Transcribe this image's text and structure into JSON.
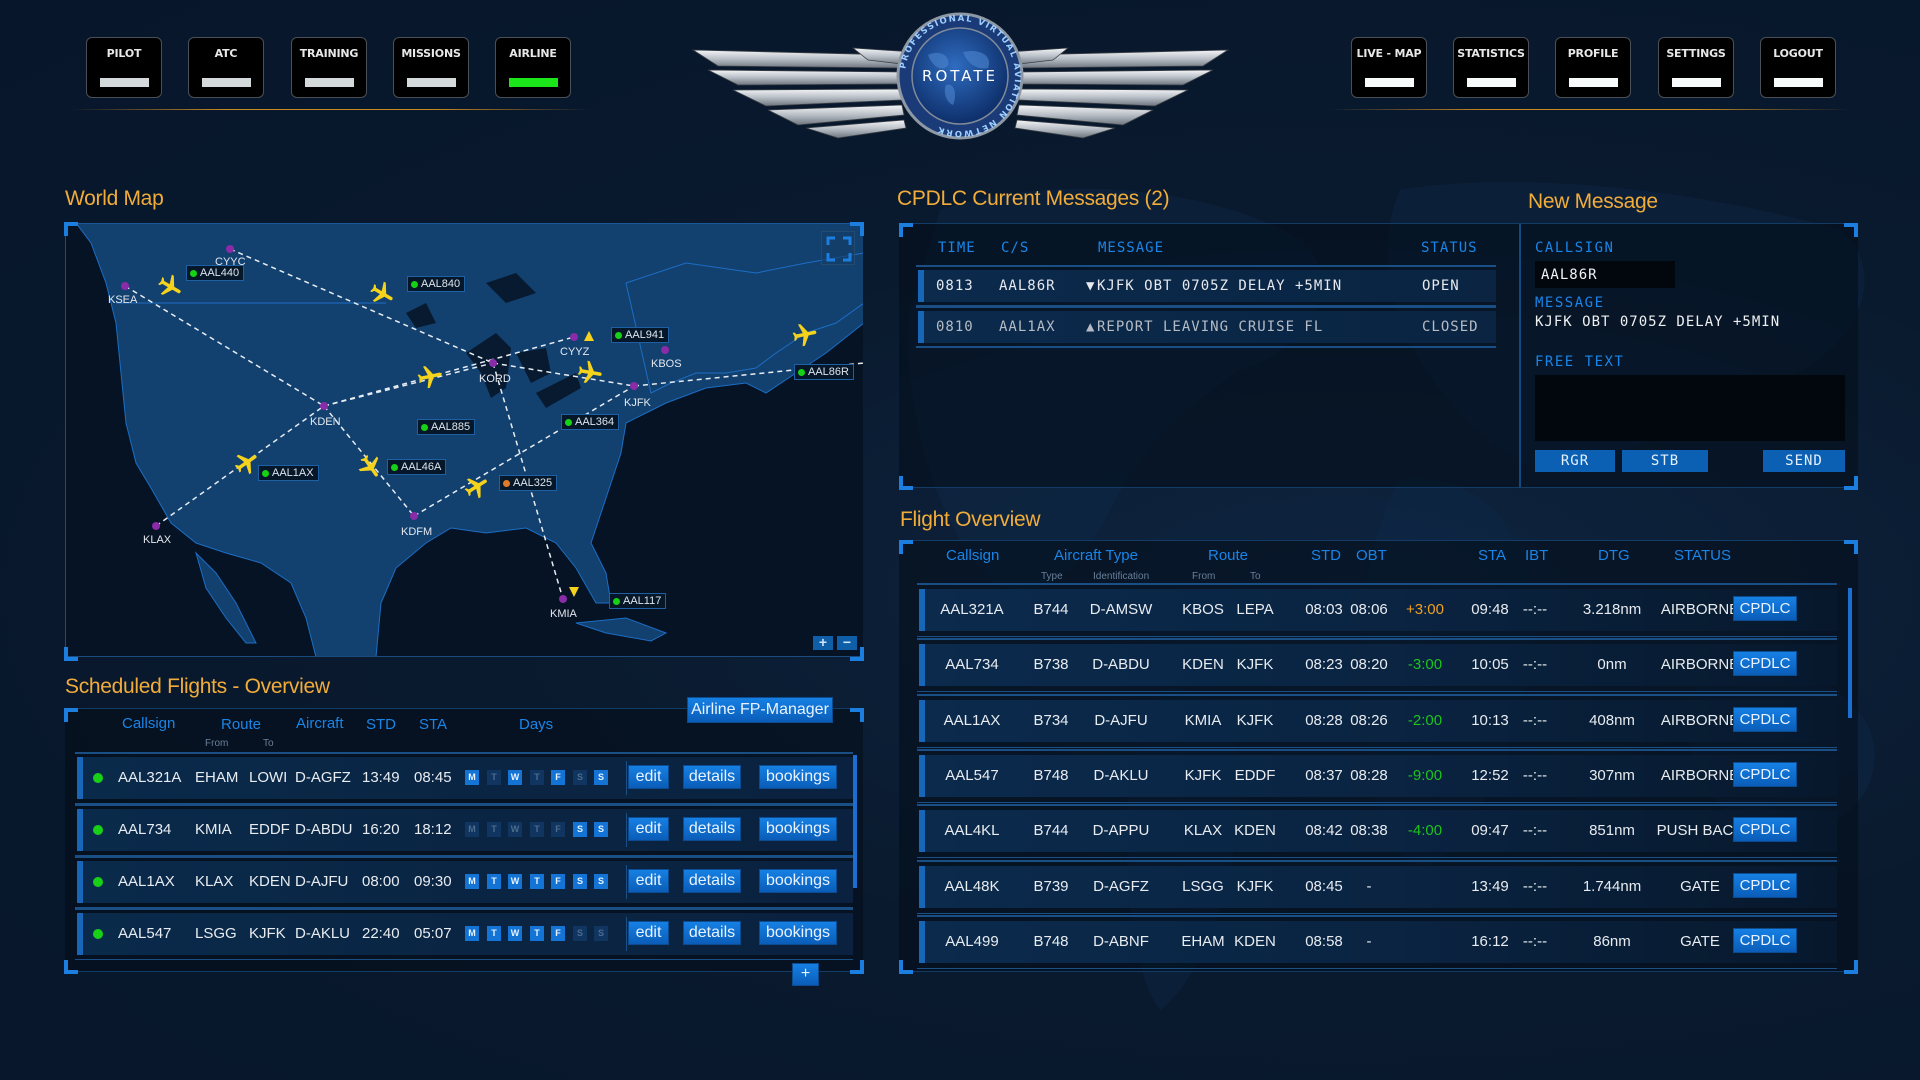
{
  "nav": {
    "left": [
      {
        "label": "PILOT",
        "active": false
      },
      {
        "label": "ATC",
        "active": false
      },
      {
        "label": "TRAINING",
        "active": false
      },
      {
        "label": "MISSIONS",
        "active": false
      },
      {
        "label": "AIRLINE",
        "active": true
      }
    ],
    "right": [
      {
        "label": "LIVE - MAP"
      },
      {
        "label": "STATISTICS"
      },
      {
        "label": "PROFILE"
      },
      {
        "label": "SETTINGS"
      },
      {
        "label": "LOGOUT"
      }
    ]
  },
  "logo": {
    "name": "ROTATE",
    "ring_text": "PROFESSIONAL VIRTUAL AVIATION NETWORK"
  },
  "colors": {
    "accent_title": "#f1ac3a",
    "header_blue": "#1a85e8",
    "button_blue": "#1474d6",
    "status_green": "#17d017",
    "delay_positive": "#f0a020",
    "delay_negative": "#1cc41c",
    "plane_yellow": "#f5d21c"
  },
  "world_map": {
    "title": "World Map",
    "airports": [
      {
        "code": "CYYC"
      },
      {
        "code": "KSEA"
      },
      {
        "code": "KDEN"
      },
      {
        "code": "KORD"
      },
      {
        "code": "CYYZ"
      },
      {
        "code": "KBOS"
      },
      {
        "code": "KJFK"
      },
      {
        "code": "KLAX"
      },
      {
        "code": "KDFM"
      },
      {
        "code": "KMIA"
      }
    ],
    "flights": [
      {
        "callsign": "AAL440",
        "status": "green"
      },
      {
        "callsign": "AAL840",
        "status": "green"
      },
      {
        "callsign": "AAL941",
        "status": "green"
      },
      {
        "callsign": "AAL885",
        "status": "green"
      },
      {
        "callsign": "AAL364",
        "status": "green"
      },
      {
        "callsign": "AAL86R",
        "status": "green"
      },
      {
        "callsign": "AAL1AX",
        "status": "green"
      },
      {
        "callsign": "AAL46A",
        "status": "green"
      },
      {
        "callsign": "AAL325",
        "status": "orange"
      },
      {
        "callsign": "AAL117",
        "status": "green"
      }
    ],
    "zoom_in": "+",
    "zoom_out": "−"
  },
  "scheduled": {
    "title": "Scheduled Flights -  Overview",
    "manager_button": "Airline FP-Manager",
    "headers": {
      "callsign": "Callsign",
      "route": "Route",
      "route_from": "From",
      "route_to": "To",
      "aircraft": "Aircraft",
      "std": "STD",
      "sta": "STA",
      "days": "Days"
    },
    "day_letters": [
      "M",
      "T",
      "W",
      "T",
      "F",
      "S",
      "S"
    ],
    "rows": [
      {
        "callsign": "AAL321A",
        "from": "EHAM",
        "to": "LOWI",
        "aircraft": "D-AGFZ",
        "std": "13:49",
        "sta": "08:45",
        "days": [
          1,
          0,
          1,
          0,
          1,
          0,
          1
        ]
      },
      {
        "callsign": "AAL734",
        "from": "KMIA",
        "to": "EDDF",
        "aircraft": "D-ABDU",
        "std": "16:20",
        "sta": "18:12",
        "days": [
          0,
          0,
          0,
          0,
          0,
          1,
          1
        ]
      },
      {
        "callsign": "AAL1AX",
        "from": "KLAX",
        "to": "KDEN",
        "aircraft": "D-AJFU",
        "std": "08:00",
        "sta": "09:30",
        "days": [
          1,
          1,
          1,
          1,
          1,
          1,
          1
        ]
      },
      {
        "callsign": "AAL547",
        "from": "LSGG",
        "to": "KJFK",
        "aircraft": "D-AKLU",
        "std": "22:40",
        "sta": "05:07",
        "days": [
          1,
          1,
          1,
          1,
          1,
          0,
          0
        ]
      }
    ],
    "row_buttons": {
      "edit": "edit",
      "details": "details",
      "bookings": "bookings"
    },
    "add_button": "+"
  },
  "cpdlc": {
    "title": "CPDLC Current Messages (2)",
    "headers": {
      "time": "TIME",
      "cs": "C/S",
      "message": "MESSAGE",
      "status": "STATUS"
    },
    "messages": [
      {
        "time": "0813",
        "cs": "AAL86R",
        "dir": "▼",
        "message": "KJFK OBT 0705Z DELAY +5MIN",
        "status": "OPEN"
      },
      {
        "time": "0810",
        "cs": "AAL1AX",
        "dir": "▲",
        "message": "REPORT LEAVING CRUISE FL",
        "status": "CLOSED"
      }
    ]
  },
  "new_message": {
    "title": "New Message",
    "callsign_label": "CALLSIGN",
    "callsign_value": "AAL86R",
    "message_label": "MESSAGE",
    "message_value": "KJFK OBT 0705Z DELAY +5MIN",
    "free_text_label": "FREE TEXT",
    "free_text_value": "",
    "buttons": {
      "rgr": "RGR",
      "stb": "STB",
      "send": "SEND"
    }
  },
  "flight_overview": {
    "title": "Flight Overview",
    "headers": {
      "callsign": "Callsign",
      "aircraft_type": "Aircraft Type",
      "type": "Type",
      "identification": "Identification",
      "route": "Route",
      "from": "From",
      "to": "To",
      "std": "STD",
      "obt": "OBT",
      "sta": "STA",
      "ibt": "IBT",
      "dtg": "DTG",
      "status": "STATUS"
    },
    "cpdlc_button": "CPDLC",
    "rows": [
      {
        "callsign": "AAL321A",
        "type": "B744",
        "ident": "D-AMSW",
        "from": "KBOS",
        "to": "LEPA",
        "std": "08:03",
        "obt": "08:06",
        "delay": "+3:00",
        "sta": "09:48",
        "ibt": "--:--",
        "dtg": "3.218nm",
        "status": "AIRBORNE"
      },
      {
        "callsign": "AAL734",
        "type": "B738",
        "ident": "D-ABDU",
        "from": "KDEN",
        "to": "KJFK",
        "std": "08:23",
        "obt": "08:20",
        "delay": "-3:00",
        "sta": "10:05",
        "ibt": "--:--",
        "dtg": "0nm",
        "status": "AIRBORNE"
      },
      {
        "callsign": "AAL1AX",
        "type": "B734",
        "ident": "D-AJFU",
        "from": "KMIA",
        "to": "KJFK",
        "std": "08:28",
        "obt": "08:26",
        "delay": "-2:00",
        "sta": "10:13",
        "ibt": "--:--",
        "dtg": "408nm",
        "status": "AIRBORNE"
      },
      {
        "callsign": "AAL547",
        "type": "B748",
        "ident": "D-AKLU",
        "from": "KJFK",
        "to": "EDDF",
        "std": "08:37",
        "obt": "08:28",
        "delay": "-9:00",
        "sta": "12:52",
        "ibt": "--:--",
        "dtg": "307nm",
        "status": "AIRBORNE"
      },
      {
        "callsign": "AAL4KL",
        "type": "B744",
        "ident": "D-APPU",
        "from": "KLAX",
        "to": "KDEN",
        "std": "08:42",
        "obt": "08:38",
        "delay": "-4:00",
        "sta": "09:47",
        "ibt": "--:--",
        "dtg": "851nm",
        "status": "PUSH BACK"
      },
      {
        "callsign": "AAL48K",
        "type": "B739",
        "ident": "D-AGFZ",
        "from": "LSGG",
        "to": "KJFK",
        "std": "08:45",
        "obt": "-",
        "delay": "",
        "sta": "13:49",
        "ibt": "--:--",
        "dtg": "1.744nm",
        "status": "GATE"
      },
      {
        "callsign": "AAL499",
        "type": "B748",
        "ident": "D-ABNF",
        "from": "EHAM",
        "to": "KDEN",
        "std": "08:58",
        "obt": "-",
        "delay": "",
        "sta": "16:12",
        "ibt": "--:--",
        "dtg": "86nm",
        "status": "GATE"
      }
    ]
  }
}
